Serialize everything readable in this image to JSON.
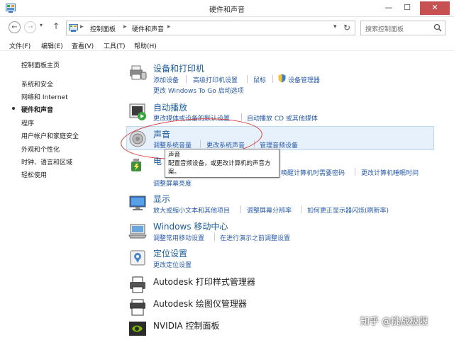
{
  "window": {
    "title": "硬件和声音",
    "close_glyph": "✕",
    "minimize_glyph": "—",
    "maximize_glyph": "☐"
  },
  "address": {
    "crumbs": [
      "控制面板",
      "硬件和声音"
    ],
    "search_placeholder": "搜索控制面板"
  },
  "menu": [
    "文件(F)",
    "编辑(E)",
    "查看(V)",
    "工具(T)",
    "帮助(H)"
  ],
  "sidebar": {
    "items": [
      {
        "label": "控制面板主页",
        "current": false
      },
      {
        "label": "系统和安全",
        "current": false
      },
      {
        "label": "网络和 Internet",
        "current": false
      },
      {
        "label": "硬件和声音",
        "current": true
      },
      {
        "label": "程序",
        "current": false
      },
      {
        "label": "用户帐户和家庭安全",
        "current": false
      },
      {
        "label": "外观和个性化",
        "current": false
      },
      {
        "label": "时钟、语言和区域",
        "current": false
      },
      {
        "label": "轻松使用",
        "current": false
      }
    ]
  },
  "categories": {
    "devices": {
      "title": "设备和打印机",
      "icon": "devices-printers-icon",
      "links": [
        "添加设备",
        "高级打印机设置",
        "鼠标",
        "设备管理器",
        "更改 Windows To Go 启动选项"
      ]
    },
    "autoplay": {
      "title": "自动播放",
      "icon": "autoplay-icon",
      "links": [
        "更改媒体或设备的默认设置",
        "自动播放 CD 或其他媒体"
      ]
    },
    "sound": {
      "title": "声音",
      "icon": "speaker-icon",
      "links": [
        "调整系统音量",
        "更改系统声音",
        "管理音频设备"
      ]
    },
    "power": {
      "title": "电",
      "icon": "power-options-icon",
      "links": [
        "唤醒计算机时需要密码",
        "更改计算机睡眠时间",
        "调整屏幕亮度"
      ]
    },
    "display": {
      "title": "显示",
      "icon": "display-monitor-icon",
      "links": [
        "放大或缩小文本和其他项目",
        "调整屏幕分辨率",
        "如何更正显示器闪烁(刷新率)"
      ]
    },
    "mobility": {
      "title": "Windows 移动中心",
      "icon": "mobility-center-icon",
      "links": [
        "调整常用移动设置",
        "在进行演示之前调整设置"
      ]
    },
    "location": {
      "title": "定位设置",
      "icon": "location-icon",
      "links": [
        "更改定位设置"
      ]
    },
    "autodesk_print": {
      "title": "Autodesk 打印样式管理器",
      "icon": "printer-style-icon"
    },
    "autodesk_plotter": {
      "title": "Autodesk 绘图仪管理器",
      "icon": "plotter-icon"
    },
    "nvidia": {
      "title": "NVIDIA 控制面板",
      "icon": "nvidia-icon"
    }
  },
  "tooltip": {
    "title": "声音",
    "description": "配置音频设备，或更改计算机的声音方案。"
  },
  "watermark": "知乎 @挑战极限",
  "colors": {
    "link": "#2a5cab",
    "category_title": "#1a5c9c",
    "highlight_bg": "#e6f1fb",
    "annotation": "#d63b3b",
    "close_button": "#c75050"
  }
}
